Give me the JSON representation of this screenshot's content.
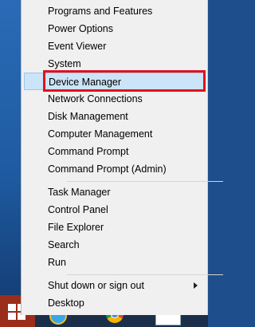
{
  "menu": {
    "items": [
      {
        "label": "Programs and Features"
      },
      {
        "label": "Power Options"
      },
      {
        "label": "Event Viewer"
      },
      {
        "label": "System"
      },
      {
        "label": "Device Manager"
      },
      {
        "label": "Network Connections"
      },
      {
        "label": "Disk Management"
      },
      {
        "label": "Computer Management"
      },
      {
        "label": "Command Prompt"
      },
      {
        "label": "Command Prompt (Admin)"
      },
      {
        "label": "Task Manager"
      },
      {
        "label": "Control Panel"
      },
      {
        "label": "File Explorer"
      },
      {
        "label": "Search"
      },
      {
        "label": "Run"
      },
      {
        "label": "Shut down or sign out"
      },
      {
        "label": "Desktop"
      }
    ],
    "highlight_color": "#e1121d",
    "hover_color": "#cce4f7"
  },
  "taskbar": {
    "icons": [
      "windows-logo-icon",
      "internet-explorer-icon",
      "chrome-icon",
      "document-icon"
    ]
  }
}
